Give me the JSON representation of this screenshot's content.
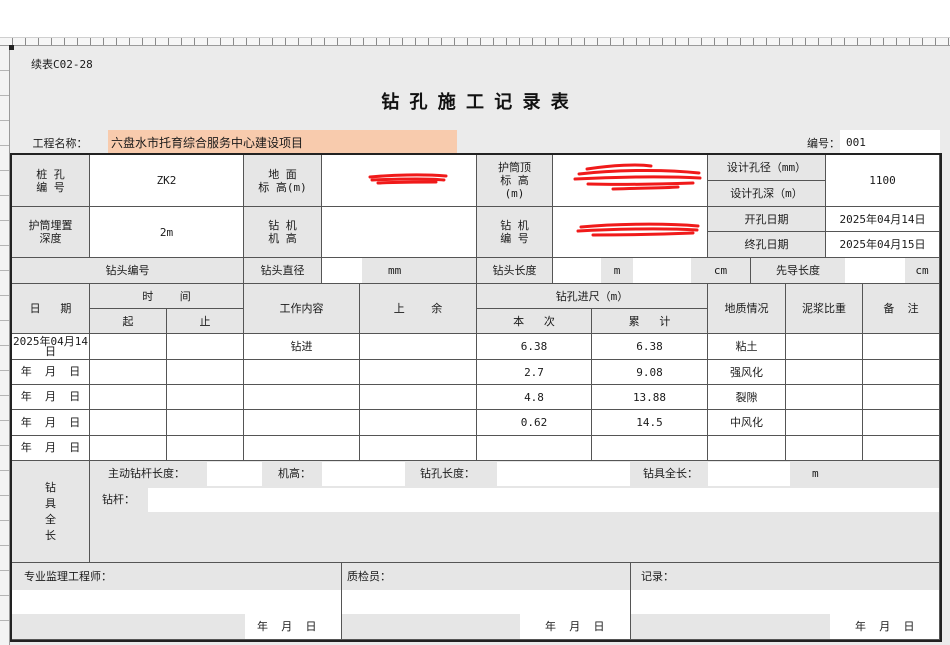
{
  "app": {
    "colors": {
      "sheet": "#ebebeb",
      "label": "#e6e6e6",
      "input": "#ffffff",
      "highlight": "#f8cbad",
      "grid": "#555555",
      "redact": "#f01a1a"
    }
  },
  "form": {
    "code": "续表C02-28",
    "title": "钻 孔 施 工 记 录 表",
    "project_label": "工程名称：",
    "project_name": "六盘水市托育综合服务中心建设项目",
    "number_label": "编号：",
    "number": "001"
  },
  "info": {
    "pile_no_label": "桩 孔\n编 号",
    "pile_no": "ZK2",
    "ground_elev_label": "地 面\n标 高(m)",
    "casing_top_label": "护筒顶\n标 高\n(m)",
    "design_diameter_label": "设计孔径（mm）",
    "design_depth_label": "设计孔深（m）",
    "design_value": "1100",
    "casing_depth_label": "护筒埋置\n深度",
    "casing_depth": "2m",
    "rig_height_label": "钻 机\n机 高",
    "rig_no_label": "钻 机\n编 号",
    "start_date_label": "开孔日期",
    "start_date": "2025年04月14日",
    "end_date_label": "终孔日期",
    "end_date": "2025年04月15日"
  },
  "bit": {
    "no_label": "钻头编号",
    "diameter_label": "钻头直径",
    "diameter_unit": "mm",
    "length_label": "钻头长度",
    "length_unit_m": "m",
    "length_unit_cm": "cm",
    "pilot_label": "先导长度",
    "pilot_unit": "cm"
  },
  "log": {
    "headers": {
      "date": "日   期",
      "time": "时    间",
      "start": "起",
      "end": "止",
      "work": "工作内容",
      "remain": "上    余",
      "footage": "钻孔进尺（m）",
      "this": "本   次",
      "total": "累   计",
      "geology": "地质情况",
      "mud": "泥浆比重",
      "remark": "备  注"
    },
    "rows": [
      {
        "date": "2025年04月14日",
        "start": "",
        "end": "",
        "work": "钻进",
        "remain": "",
        "this": "6.38",
        "total": "6.38",
        "geology": "粘土",
        "mud": "",
        "remark": ""
      },
      {
        "date": "年  月  日",
        "start": "",
        "end": "",
        "work": "",
        "remain": "",
        "this": "2.7",
        "total": "9.08",
        "geology": "强风化",
        "mud": "",
        "remark": ""
      },
      {
        "date": "年  月  日",
        "start": "",
        "end": "",
        "work": "",
        "remain": "",
        "this": "4.8",
        "total": "13.88",
        "geology": "裂隙",
        "mud": "",
        "remark": ""
      },
      {
        "date": "年  月  日",
        "start": "",
        "end": "",
        "work": "",
        "remain": "",
        "this": "0.62",
        "total": "14.5",
        "geology": "中风化",
        "mud": "",
        "remark": ""
      },
      {
        "date": "年  月  日",
        "start": "",
        "end": "",
        "work": "",
        "remain": "",
        "this": "",
        "total": "",
        "geology": "",
        "mud": "",
        "remark": ""
      }
    ]
  },
  "tool": {
    "label": "钻\n具\n全\n长",
    "kelly_label": "主动钻杆长度：",
    "rig_height_label": "机高：",
    "hole_length_label": "钻孔长度：",
    "total_label": "钻具全长：",
    "total_unit": "m",
    "rod_label": "钻杆："
  },
  "signatures": [
    {
      "label": "专业监理工程师：",
      "date": "年  月  日"
    },
    {
      "label": "质检员：",
      "date": "年  月  日"
    },
    {
      "label": "记录：",
      "date": "年  月  日"
    }
  ]
}
